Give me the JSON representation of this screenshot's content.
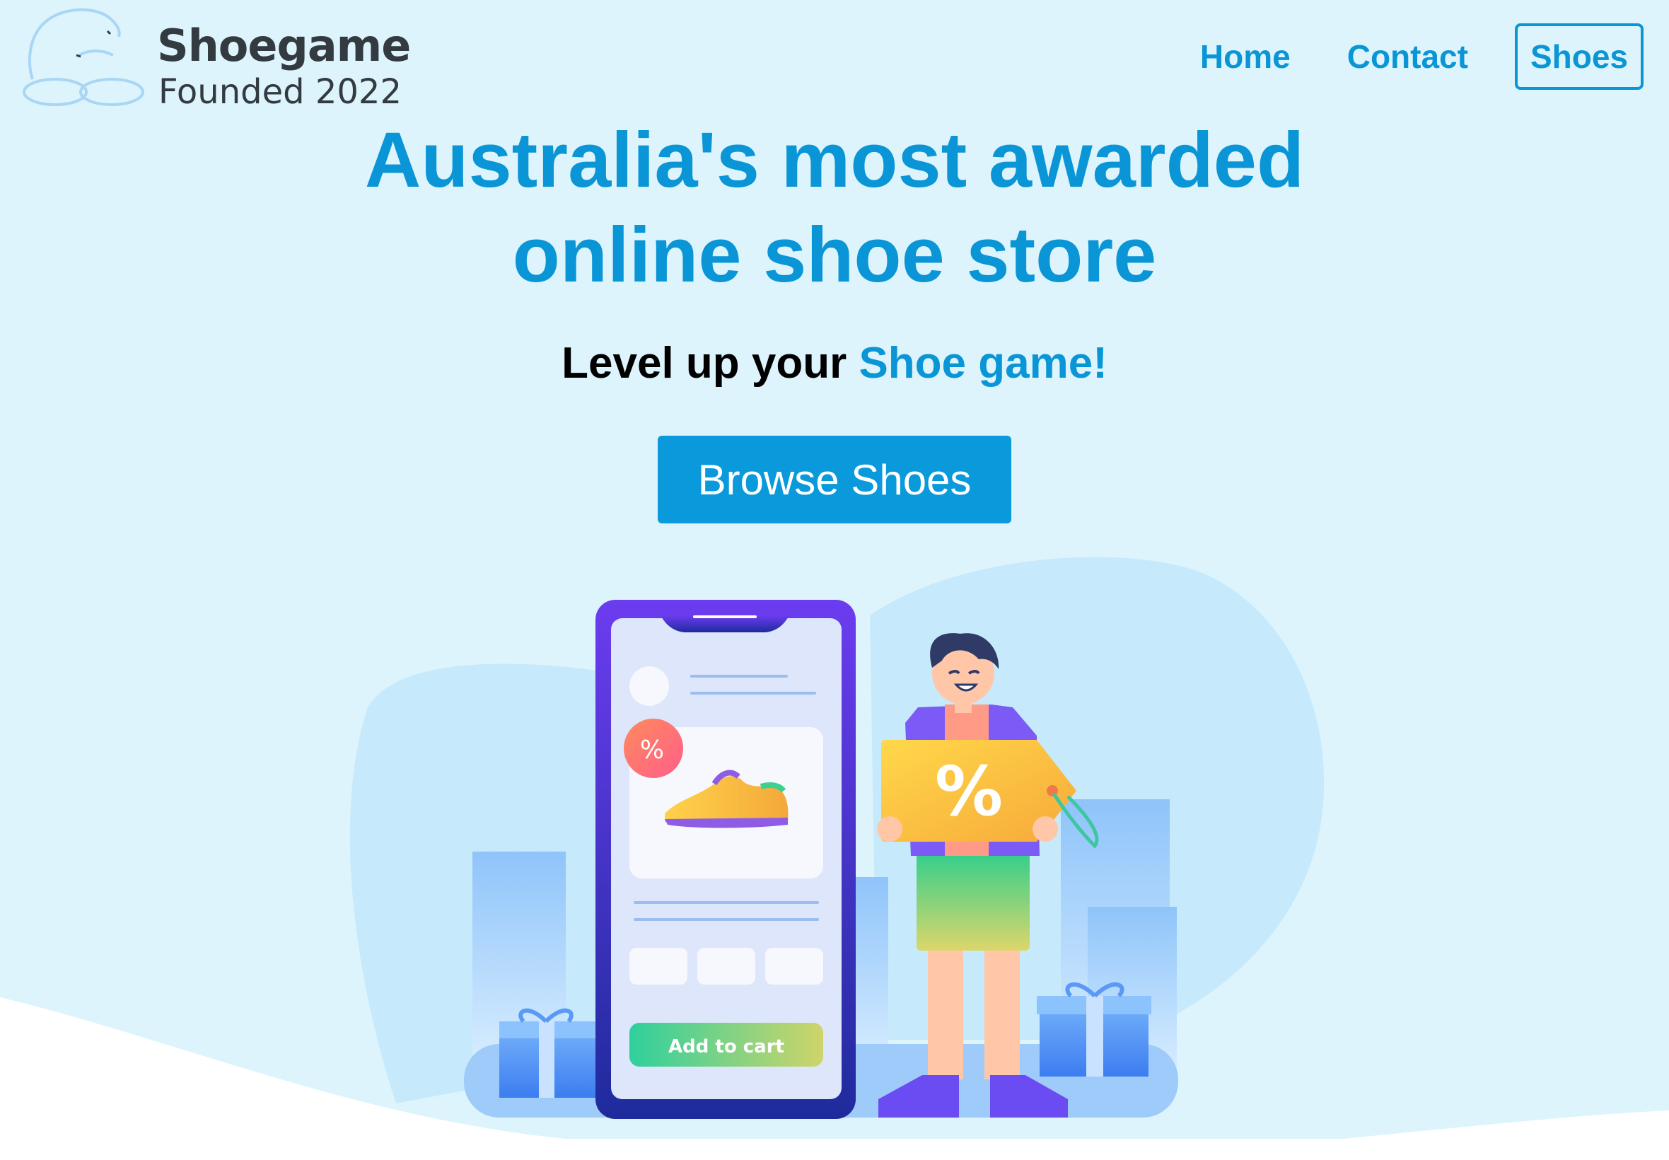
{
  "header": {
    "brand_name": "Shoegame",
    "brand_tagline": "Founded 2022",
    "logo_icon": "shoe-outline-icon"
  },
  "nav": {
    "items": [
      {
        "label": "Home",
        "active": false
      },
      {
        "label": "Contact",
        "active": false
      },
      {
        "label": "Shoes",
        "active": true
      }
    ]
  },
  "hero": {
    "title_line1": "Australia's most awarded",
    "title_line2": "online shoe store",
    "subtitle_prefix": "Level up your",
    "subtitle_accent": "Shoe game!",
    "cta_label": "Browse Shoes"
  },
  "illustration": {
    "discount_badge": "%",
    "tag_label": "%",
    "cart_button_label": "Add to cart"
  },
  "colors": {
    "background": "#ddf4fc",
    "primary": "#0a96d6",
    "text_dark": "#333a40"
  }
}
